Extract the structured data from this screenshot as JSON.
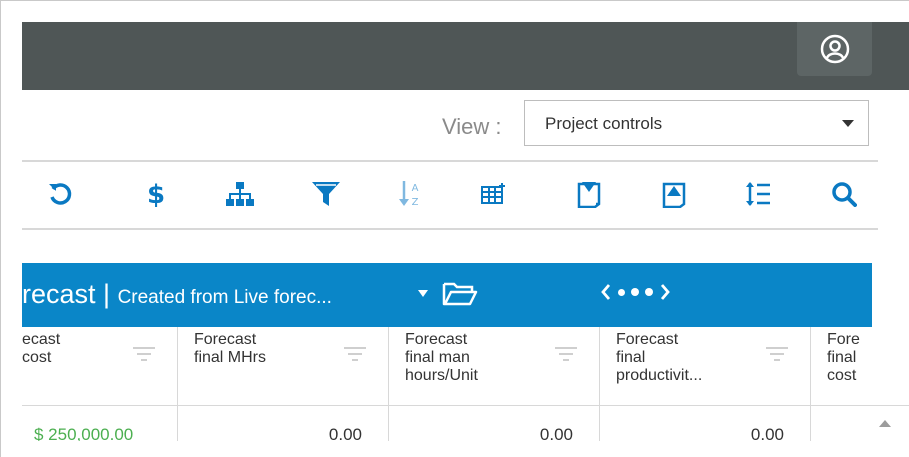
{
  "colors": {
    "topbar": "#4f5656",
    "accent": "#0a86c8",
    "toolbar_icon": "#0a79c2",
    "money_green": "#4caf50"
  },
  "topbar": {
    "user_icon": "user-circle-icon"
  },
  "view": {
    "label": "View :",
    "selected": "Project controls"
  },
  "toolbar": {
    "icons": [
      "refresh-icon",
      "dollar-icon",
      "hierarchy-icon",
      "filter-icon",
      "sort-az-icon",
      "table-columns-icon",
      "export-down-icon",
      "import-up-icon",
      "line-height-icon",
      "search-icon"
    ]
  },
  "grid": {
    "title_main": "recast",
    "title_sep": " | ",
    "title_sub": "Created from Live forec...",
    "columns": [
      {
        "label": "ecast\n cost"
      },
      {
        "label": "Forecast\nfinal MHrs"
      },
      {
        "label": "Forecast\nfinal man\nhours/Unit"
      },
      {
        "label": "Forecast\nfinal\nproductivit..."
      },
      {
        "label": "Fore\nfinal\ncost"
      }
    ],
    "row1": [
      "$ 250,000.00",
      "0.00",
      "0.00",
      "0.00",
      ""
    ]
  }
}
